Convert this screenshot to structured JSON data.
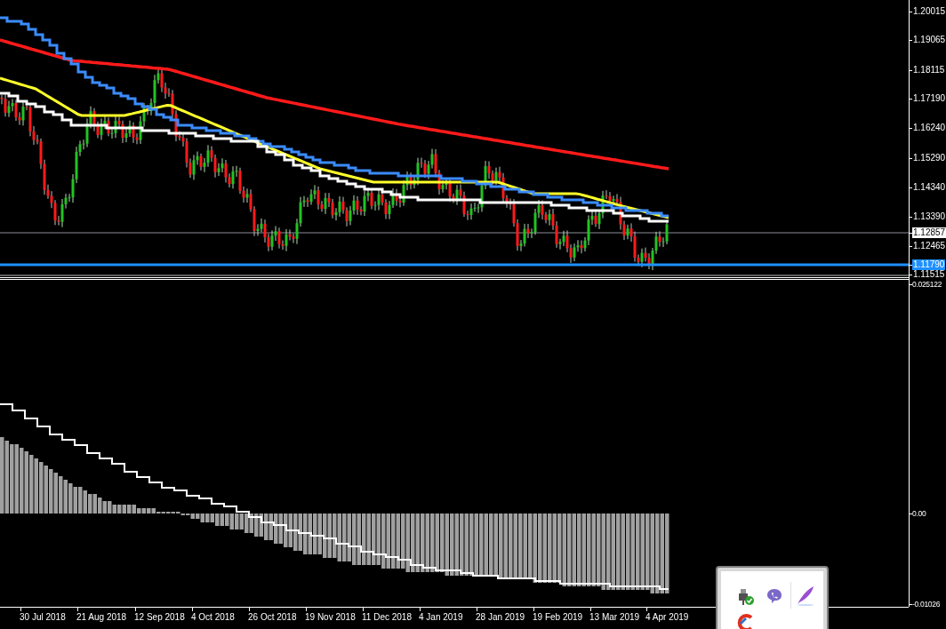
{
  "price_axis": {
    "labels": [
      {
        "text": "1.20015",
        "kind": "tick"
      },
      {
        "text": "1.19065",
        "kind": "tick"
      },
      {
        "text": "1.18115",
        "kind": "tick"
      },
      {
        "text": "1.17190",
        "kind": "tick"
      },
      {
        "text": "1.16240",
        "kind": "tick"
      },
      {
        "text": "1.15290",
        "kind": "tick"
      },
      {
        "text": "1.14340",
        "kind": "tick"
      },
      {
        "text": "1.13390",
        "kind": "tick"
      },
      {
        "text": "1.12857",
        "kind": "current"
      },
      {
        "text": "1.12465",
        "kind": "tick"
      },
      {
        "text": "1.11790",
        "kind": "level"
      },
      {
        "text": "1.11515",
        "kind": "tick"
      }
    ]
  },
  "indicator_axis": {
    "labels": [
      {
        "text": "0.025122"
      },
      {
        "text": "0.00"
      },
      {
        "text": "-0.01026"
      }
    ]
  },
  "time_axis": {
    "labels": [
      {
        "text": "30 Jul 2018"
      },
      {
        "text": "21 Aug 2018"
      },
      {
        "text": "12 Sep 2018"
      },
      {
        "text": "4 Oct 2018"
      },
      {
        "text": "26 Oct 2018"
      },
      {
        "text": "19 Nov 2018"
      },
      {
        "text": "11 Dec 2018"
      },
      {
        "text": "4 Jan 2019"
      },
      {
        "text": "28 Jan 2019"
      },
      {
        "text": "19 Feb 2019"
      },
      {
        "text": "13 Mar 2019"
      },
      {
        "text": "4 Apr 2019"
      }
    ]
  }
}
